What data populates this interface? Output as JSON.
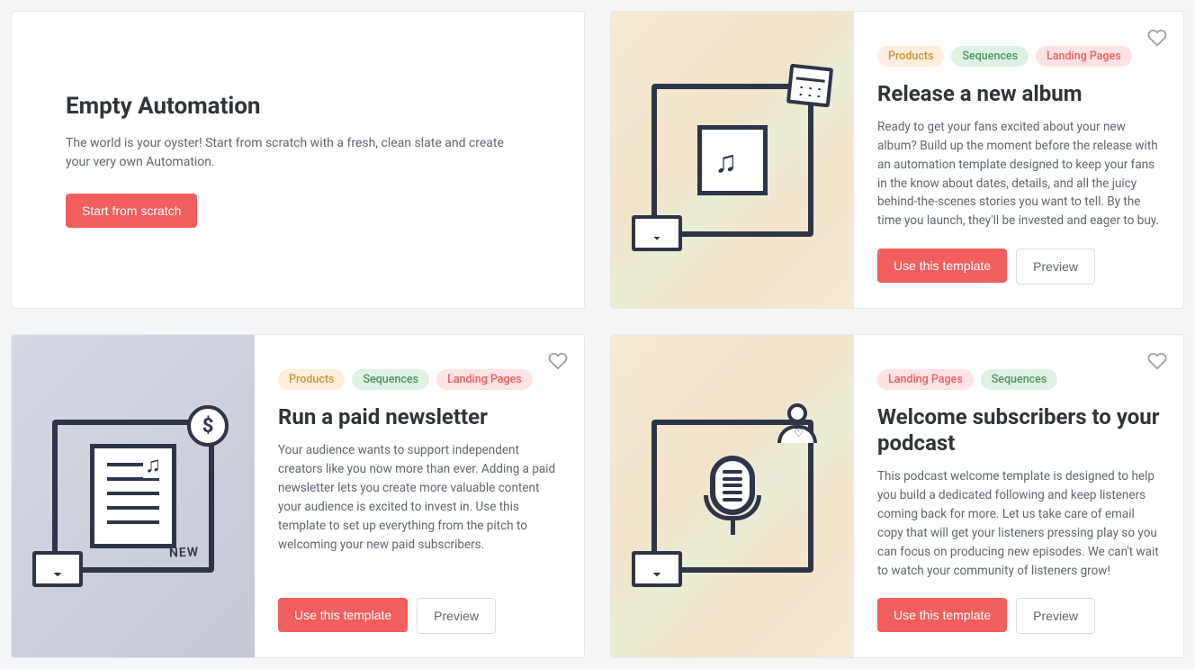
{
  "empty": {
    "title": "Empty Automation",
    "description": "The world is your oyster! Start from scratch with a fresh, clean slate and create your very own Automation.",
    "cta": "Start from scratch"
  },
  "common": {
    "use_template": "Use this template",
    "preview": "Preview"
  },
  "tag_labels": {
    "products": "Products",
    "sequences": "Sequences",
    "landing_pages": "Landing Pages"
  },
  "templates": [
    {
      "title": "Release a new album",
      "description": "Ready to get your fans excited about your new album? Build up the moment before the release with an automation template designed to keep your fans in the know about dates, details, and all the juicy behind-the-scenes stories you want to tell. By the time you launch, they'll be invested and eager to buy.",
      "tags": [
        "products",
        "sequences",
        "landing_pages"
      ]
    },
    {
      "title": "Run a paid newsletter",
      "description": "Your audience wants to support independent creators like you now more than ever. Adding a paid newsletter lets you create more valuable content your audience is excited to invest in. Use this template to set up everything from the pitch to welcoming your new paid subscribers.",
      "tags": [
        "products",
        "sequences",
        "landing_pages"
      ]
    },
    {
      "title": "Welcome subscribers to your podcast",
      "description": "This podcast welcome template is designed to help you build a dedicated following and keep listeners coming back for more. Let us take care of email copy that will get your listeners pressing play so you can focus on producing new episodes. We can't wait to watch your community of listeners grow!",
      "tags": [
        "landing_pages",
        "sequences"
      ]
    }
  ]
}
